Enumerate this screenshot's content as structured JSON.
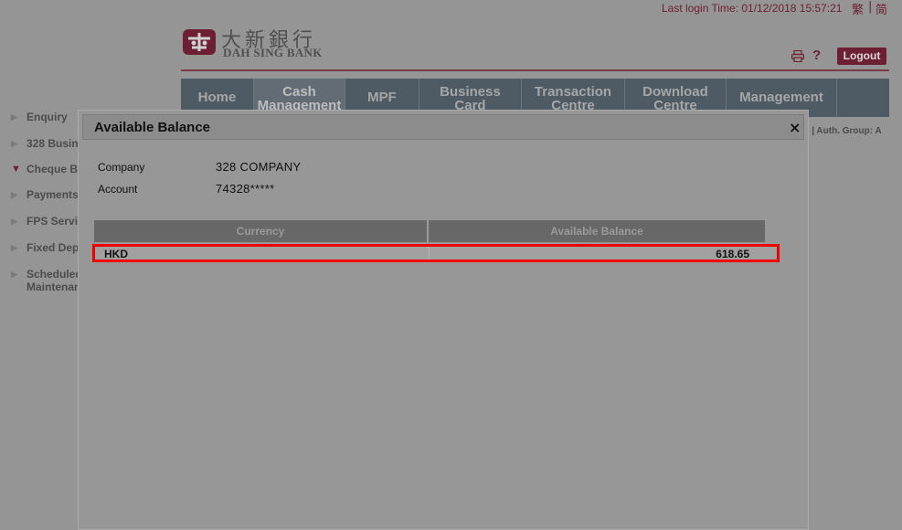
{
  "header": {
    "last_login": "Last login Time: 01/12/2018 15:57:21",
    "lang_traditional": "繁",
    "lang_separator": "|",
    "lang_simplified": "简",
    "logo_cn": "大新銀行",
    "logo_en": "DAH SING BANK",
    "help_label": "?",
    "logout_label": "Logout"
  },
  "nav": {
    "tabs": [
      {
        "lines": [
          "Home"
        ]
      },
      {
        "lines": [
          "Cash",
          "Management"
        ],
        "active": true
      },
      {
        "lines": [
          "MPF"
        ]
      },
      {
        "lines": [
          "Business",
          "Card"
        ]
      },
      {
        "lines": [
          "Transaction",
          "Centre"
        ]
      },
      {
        "lines": [
          "Download",
          "Centre"
        ]
      },
      {
        "lines": [
          "Management"
        ]
      }
    ]
  },
  "sidebar": {
    "items": [
      {
        "label": "Enquiry",
        "expanded": false
      },
      {
        "label": "328 Busin",
        "expanded": false
      },
      {
        "label": "Cheque B",
        "expanded": true
      },
      {
        "label": "Payments",
        "expanded": false
      },
      {
        "label": "FPS Servi",
        "expanded": false
      },
      {
        "label": "Fixed Dep",
        "expanded": false
      },
      {
        "label": "Scheduled",
        "label2": "Maintenan",
        "expanded": false
      }
    ]
  },
  "auth_fragment": "er | Auth. Group: A",
  "modal": {
    "title": "Available Balance",
    "close_label": "×",
    "company_label": "Company",
    "company_value": "328 COMPANY",
    "account_label": "Account",
    "account_value": "74328*****",
    "table": {
      "headers": [
        "Currency",
        "Available Balance"
      ],
      "rows": [
        [
          "HKD",
          "618.65"
        ]
      ]
    }
  },
  "colors": {
    "brand": "#6d1f33",
    "highlight": "#f00000",
    "nav_bg": "#4e5a64"
  },
  "icons": [
    "printer-icon",
    "help-icon",
    "close-icon",
    "arrow-right-icon",
    "arrow-down-icon"
  ]
}
